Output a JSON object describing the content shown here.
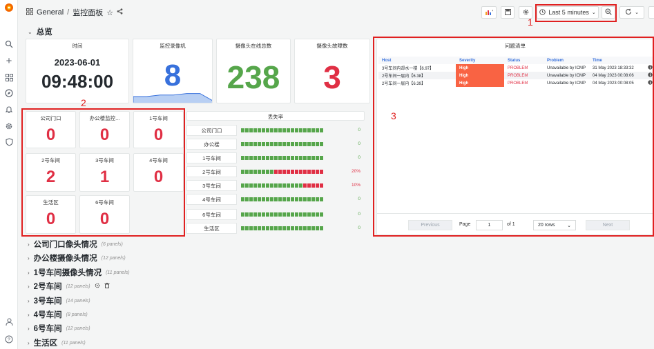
{
  "colors": {
    "red": "#e02f44",
    "green": "#56a64b",
    "blue": "#3871dc",
    "annotation": "#e02020"
  },
  "breadcrumb": {
    "folder": "General",
    "separator": "/",
    "dashboard": "监控面板"
  },
  "toolbar": {
    "time_range": "Last 5 minutes",
    "zoom_icon": "zoom-out-icon",
    "refresh_icon": "refresh-icon"
  },
  "annotations": [
    "1",
    "2",
    "3"
  ],
  "section": {
    "title": "总览"
  },
  "stat_panels": {
    "time": {
      "title": "时间",
      "date": "2023-06-01",
      "clock": "09:48:00"
    },
    "recorders": {
      "title": "监控录像机",
      "value": "8",
      "sparkline": [
        0.25,
        0.25,
        0.3,
        0.3,
        0.35,
        0.35,
        0.1
      ]
    },
    "cameras_online": {
      "title": "摄像头在线总数",
      "value": "238"
    },
    "cameras_fault": {
      "title": "摄像头故障数",
      "value": "3"
    }
  },
  "small_panels": [
    {
      "title": "公司门口",
      "value": "0"
    },
    {
      "title": "办公楼监控...",
      "value": "0"
    },
    {
      "title": "1号车间",
      "value": "0"
    },
    {
      "title": "2号车间",
      "value": "2"
    },
    {
      "title": "3号车间",
      "value": "1"
    },
    {
      "title": "4号车间",
      "value": "0"
    },
    {
      "title": "生活区",
      "value": "0"
    },
    {
      "title": "6号车间",
      "value": "0"
    }
  ],
  "loss_panel": {
    "title": "丢失率",
    "rows": [
      {
        "label": "公司门口",
        "percent_text": "0",
        "red_fraction": 0
      },
      {
        "label": "办公楼",
        "percent_text": "0",
        "red_fraction": 0
      },
      {
        "label": "1号车间",
        "percent_text": "0",
        "red_fraction": 0
      },
      {
        "label": "2号车间",
        "percent_text": "20%",
        "red_fraction": 0.6
      },
      {
        "label": "3号车间",
        "percent_text": "10%",
        "red_fraction": 0.25
      },
      {
        "label": "4号车间",
        "percent_text": "0",
        "red_fraction": 0
      },
      {
        "label": "6号车间",
        "percent_text": "0",
        "red_fraction": 0
      },
      {
        "label": "生活区",
        "percent_text": "0",
        "red_fraction": 0
      }
    ]
  },
  "problems_panel": {
    "title": "问题清单",
    "columns": [
      "Host",
      "Severity",
      "Status",
      "Problem",
      "Time"
    ],
    "rows": [
      {
        "host": "3号车间内却水一楼【6.97】",
        "severity": "High",
        "status": "PROBLEM",
        "problem": "Unavailable by ICMP",
        "time": "31 May 2023 18:33:32"
      },
      {
        "host": "2号车间一层内【6.38】",
        "severity": "High",
        "status": "PROBLEM",
        "problem": "Unavailable by ICMP",
        "time": "04 May 2023 00:08:06"
      },
      {
        "host": "2号车间一层内【6.39】",
        "severity": "High",
        "status": "PROBLEM",
        "problem": "Unavailable by ICMP",
        "time": "04 May 2023 00:08:05"
      }
    ],
    "pagination": {
      "previous": "Previous",
      "page_label": "Page",
      "page": "1",
      "of": "of 1",
      "rows": "20 rows",
      "next": "Next"
    }
  },
  "collapsed_rows": [
    {
      "title": "公司门口像头情况",
      "count": "(6 panels)"
    },
    {
      "title": "办公楼摄像头情况",
      "count": "(12 panels)"
    },
    {
      "title": "1号车间摄像头情况",
      "count": "(11 panels)"
    },
    {
      "title": "2号车间",
      "count": "(12 panels)"
    },
    {
      "title": "3号车间",
      "count": "(14 panels)"
    },
    {
      "title": "4号车间",
      "count": "(8 panels)"
    },
    {
      "title": "6号车间",
      "count": "(12 panels)"
    },
    {
      "title": "生活区",
      "count": "(11 panels)"
    }
  ]
}
